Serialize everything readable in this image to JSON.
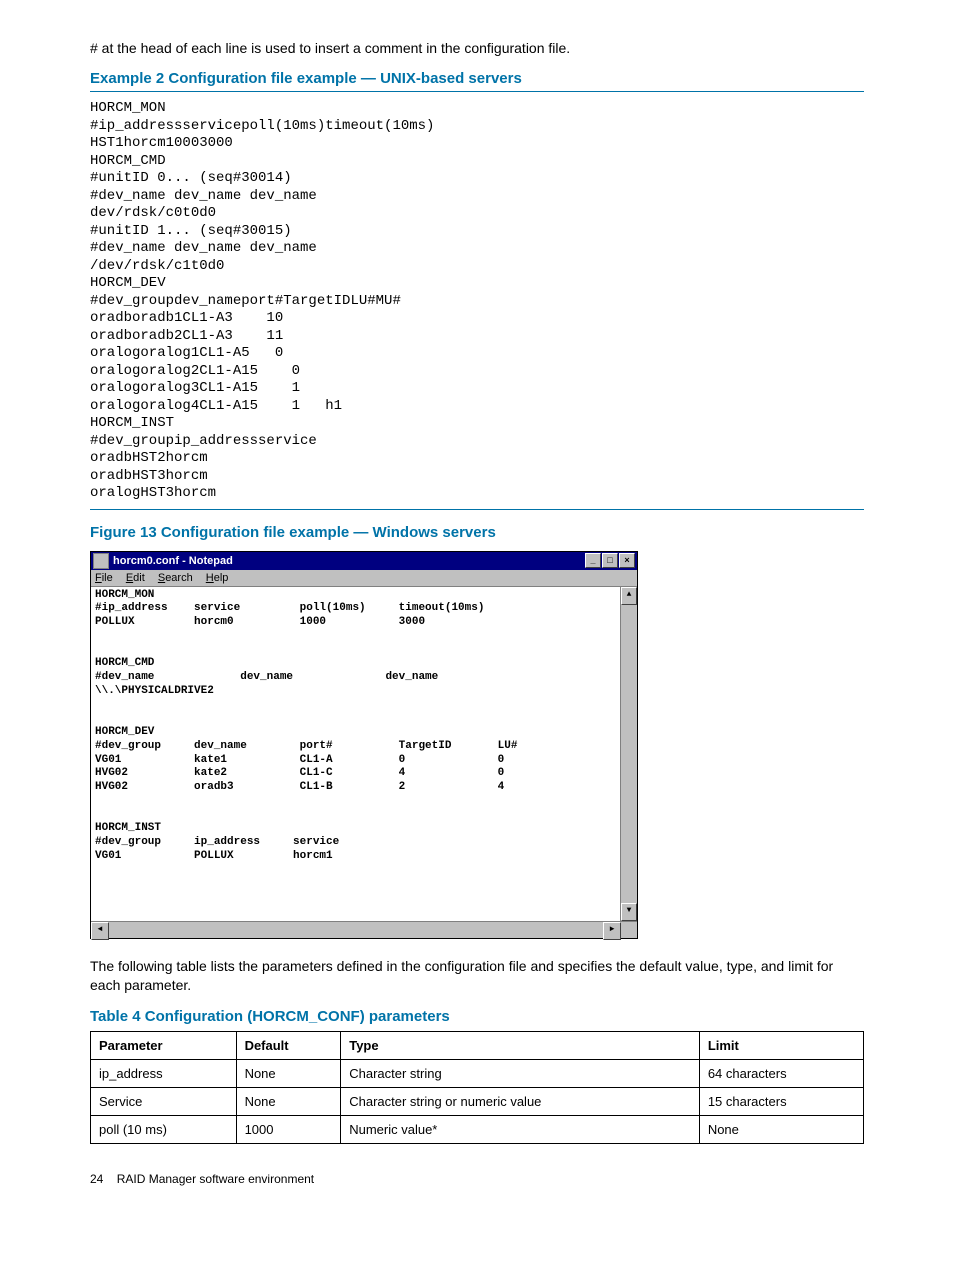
{
  "intro": "# at the head of each line is used to insert a comment in the configuration file.",
  "example2": {
    "title": "Example 2 Configuration file example — UNIX-based servers",
    "code": "HORCM_MON\n#ip_addressservicepoll(10ms)timeout(10ms)\nHST1horcm10003000\nHORCM_CMD\n#unitID 0... (seq#30014)\n#dev_name dev_name dev_name\ndev/rdsk/c0t0d0\n#unitID 1... (seq#30015)\n#dev_name dev_name dev_name\n/dev/rdsk/c1t0d0\nHORCM_DEV\n#dev_groupdev_nameport#TargetIDLU#MU#\noradboradb1CL1-A3    10\noradboradb2CL1-A3    11\noralogoralog1CL1-A5   0\noralogoralog2CL1-A15    0\noralogoralog3CL1-A15    1\noralogoralog4CL1-A15    1   h1\nHORCM_INST\n#dev_groupip_addressservice\noradbHST2horcm\noradbHST3horcm\noralogHST3horcm"
  },
  "figure13": {
    "title": "Figure 13 Configuration file example — Windows servers",
    "notepad": {
      "window_title": "horcm0.conf - Notepad",
      "menus": {
        "file": "File",
        "edit": "Edit",
        "search": "Search",
        "help": "Help"
      },
      "content": "HORCM_MON\n#ip_address    service         poll(10ms)     timeout(10ms)\nPOLLUX         horcm0          1000           3000\n\n\nHORCM_CMD\n#dev_name             dev_name              dev_name\n\\\\.\\PHYSICALDRIVE2\n\n\nHORCM_DEV\n#dev_group     dev_name        port#          TargetID       LU#\nVG01           kate1           CL1-A          0              0\nHVG02          kate2           CL1-C          4              0\nHVG02          oradb3          CL1-B          2              4\n\n\nHORCM_INST\n#dev_group     ip_address     service\nVG01           POLLUX         horcm1"
    }
  },
  "table_intro": "The following table lists the parameters defined in the configuration file and specifies the default value, type, and limit for each parameter.",
  "table4": {
    "title": "Table 4 Configuration (HORCM_CONF) parameters",
    "headers": {
      "c1": "Parameter",
      "c2": "Default",
      "c3": "Type",
      "c4": "Limit"
    },
    "rows": [
      {
        "c1": "ip_address",
        "c2": "None",
        "c3": "Character string",
        "c4": "64 characters"
      },
      {
        "c1": "Service",
        "c2": "None",
        "c3": "Character string or numeric value",
        "c4": "15 characters"
      },
      {
        "c1": "poll (10 ms)",
        "c2": "1000",
        "c3": "Numeric value*",
        "c4": "None"
      }
    ]
  },
  "footer": {
    "page": "24",
    "section": "RAID Manager software environment"
  }
}
